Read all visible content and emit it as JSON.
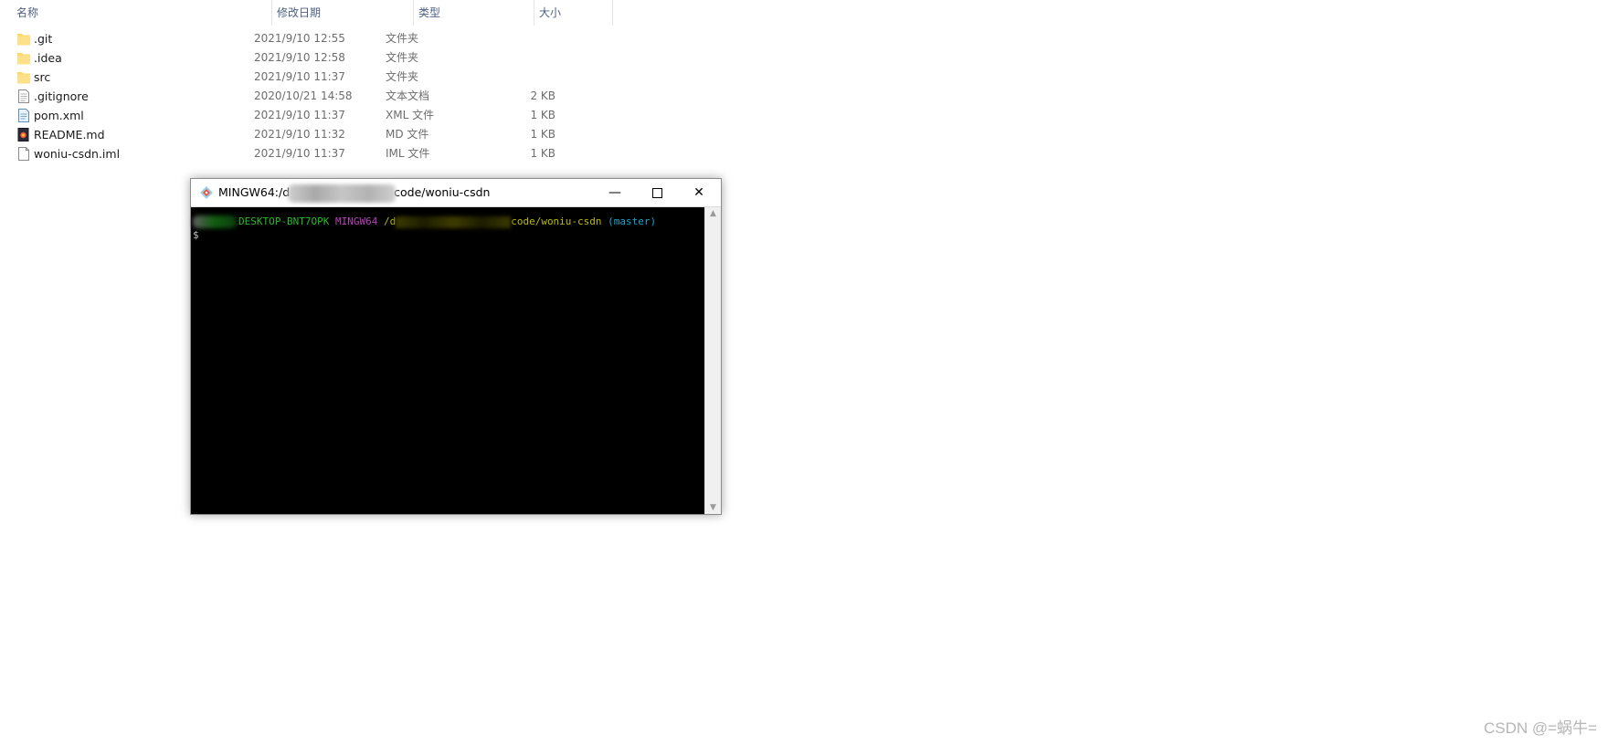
{
  "explorer": {
    "columns": {
      "name": "名称",
      "modified": "修改日期",
      "type": "类型",
      "size": "大小"
    },
    "sort_indicator": "^",
    "files": [
      {
        "name": ".git",
        "modified": "2021/9/10 12:55",
        "type": "文件夹",
        "size": "",
        "icon": "folder-icon"
      },
      {
        "name": ".idea",
        "modified": "2021/9/10 12:58",
        "type": "文件夹",
        "size": "",
        "icon": "folder-icon"
      },
      {
        "name": "src",
        "modified": "2021/9/10 11:37",
        "type": "文件夹",
        "size": "",
        "icon": "folder-icon"
      },
      {
        "name": ".gitignore",
        "modified": "2020/10/21 14:58",
        "type": "文本文档",
        "size": "2 KB",
        "icon": "text-file-icon"
      },
      {
        "name": "pom.xml",
        "modified": "2021/9/10 11:37",
        "type": "XML 文件",
        "size": "1 KB",
        "icon": "xml-file-icon"
      },
      {
        "name": "README.md",
        "modified": "2021/9/10 11:32",
        "type": "MD 文件",
        "size": "1 KB",
        "icon": "markdown-file-icon"
      },
      {
        "name": "woniu-csdn.iml",
        "modified": "2021/9/10 11:37",
        "type": "IML 文件",
        "size": "1 KB",
        "icon": "blank-file-icon"
      }
    ]
  },
  "terminal": {
    "title_prefix": "MINGW64:/d",
    "title_suffix": "code/woniu-csdn",
    "controls": {
      "minimize": "—",
      "close": "✕"
    },
    "prompt": {
      "host": "DESKTOP-BNT7OPK",
      "env": "MINGW64",
      "path_prefix": "/d",
      "path_suffix": "code/woniu-csdn",
      "branch": "(master)",
      "symbol": "$"
    },
    "scroll": {
      "up": "▲",
      "down": "▼"
    }
  },
  "watermark": "CSDN @=蜗牛=",
  "colors": {
    "folder": "#ffd766",
    "terminal_bg": "#000000",
    "host_green": "#25bc24",
    "mingw_magenta": "#bc3fbc",
    "path_yellow": "#bcbc00",
    "branch_cyan": "#11a8cd"
  }
}
